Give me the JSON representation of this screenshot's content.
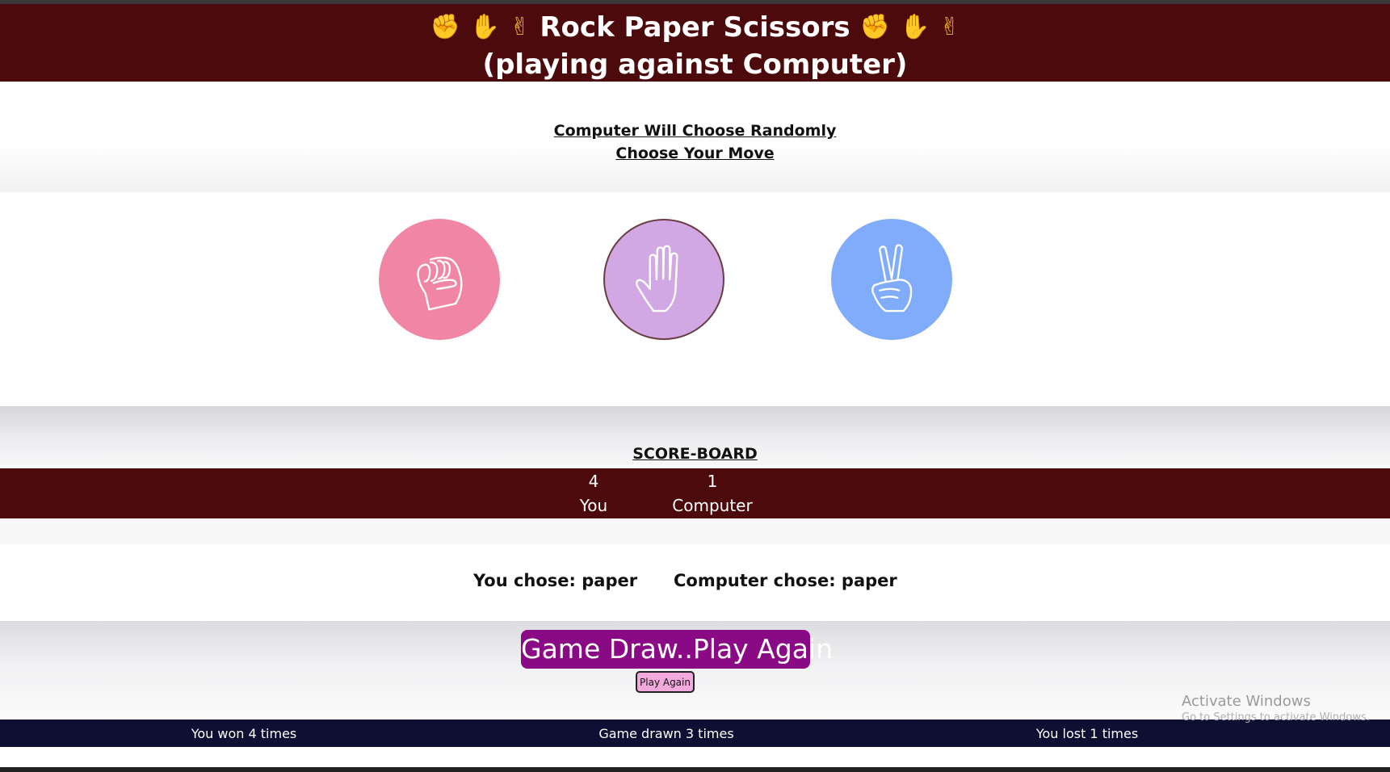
{
  "header": {
    "title": "Rock Paper Scissors",
    "subtitle": "(playing against Computer)",
    "emojis_left": [
      "✊",
      "✋",
      "✌"
    ],
    "emojis_right": [
      "✊",
      "✋",
      "✌"
    ]
  },
  "instructions": {
    "line1": "Computer Will Choose Randomly",
    "line2": "Choose Your Move"
  },
  "choices": [
    {
      "name": "rock",
      "icon": "fist-icon",
      "color": "#f085a5"
    },
    {
      "name": "paper",
      "icon": "open-hand-icon",
      "color": "#d1a8e3"
    },
    {
      "name": "scissors",
      "icon": "peace-hand-icon",
      "color": "#80acfb"
    }
  ],
  "scoreboard": {
    "title": "SCORE-BOARD",
    "you_score": "4",
    "you_label": "You",
    "computer_score": "1",
    "computer_label": "Computer"
  },
  "last_round": {
    "you_chose": "You chose: paper",
    "computer_chose": "Computer chose: paper"
  },
  "result": {
    "message": "Game Draw..Play Again",
    "play_again_label": "Play Again"
  },
  "footer": {
    "won": "You won 4 times",
    "drawn": "Game drawn 3 times",
    "lost": "You lost 1 times"
  },
  "watermark": {
    "line1": "Activate Windows",
    "line2": "Go to Settings to activate Windows."
  },
  "colors": {
    "header_bg": "#4d0a0c",
    "result_bg": "#8a0a86",
    "play_btn_bg": "#f3a9dc",
    "footer_bg": "#0e0f33"
  }
}
